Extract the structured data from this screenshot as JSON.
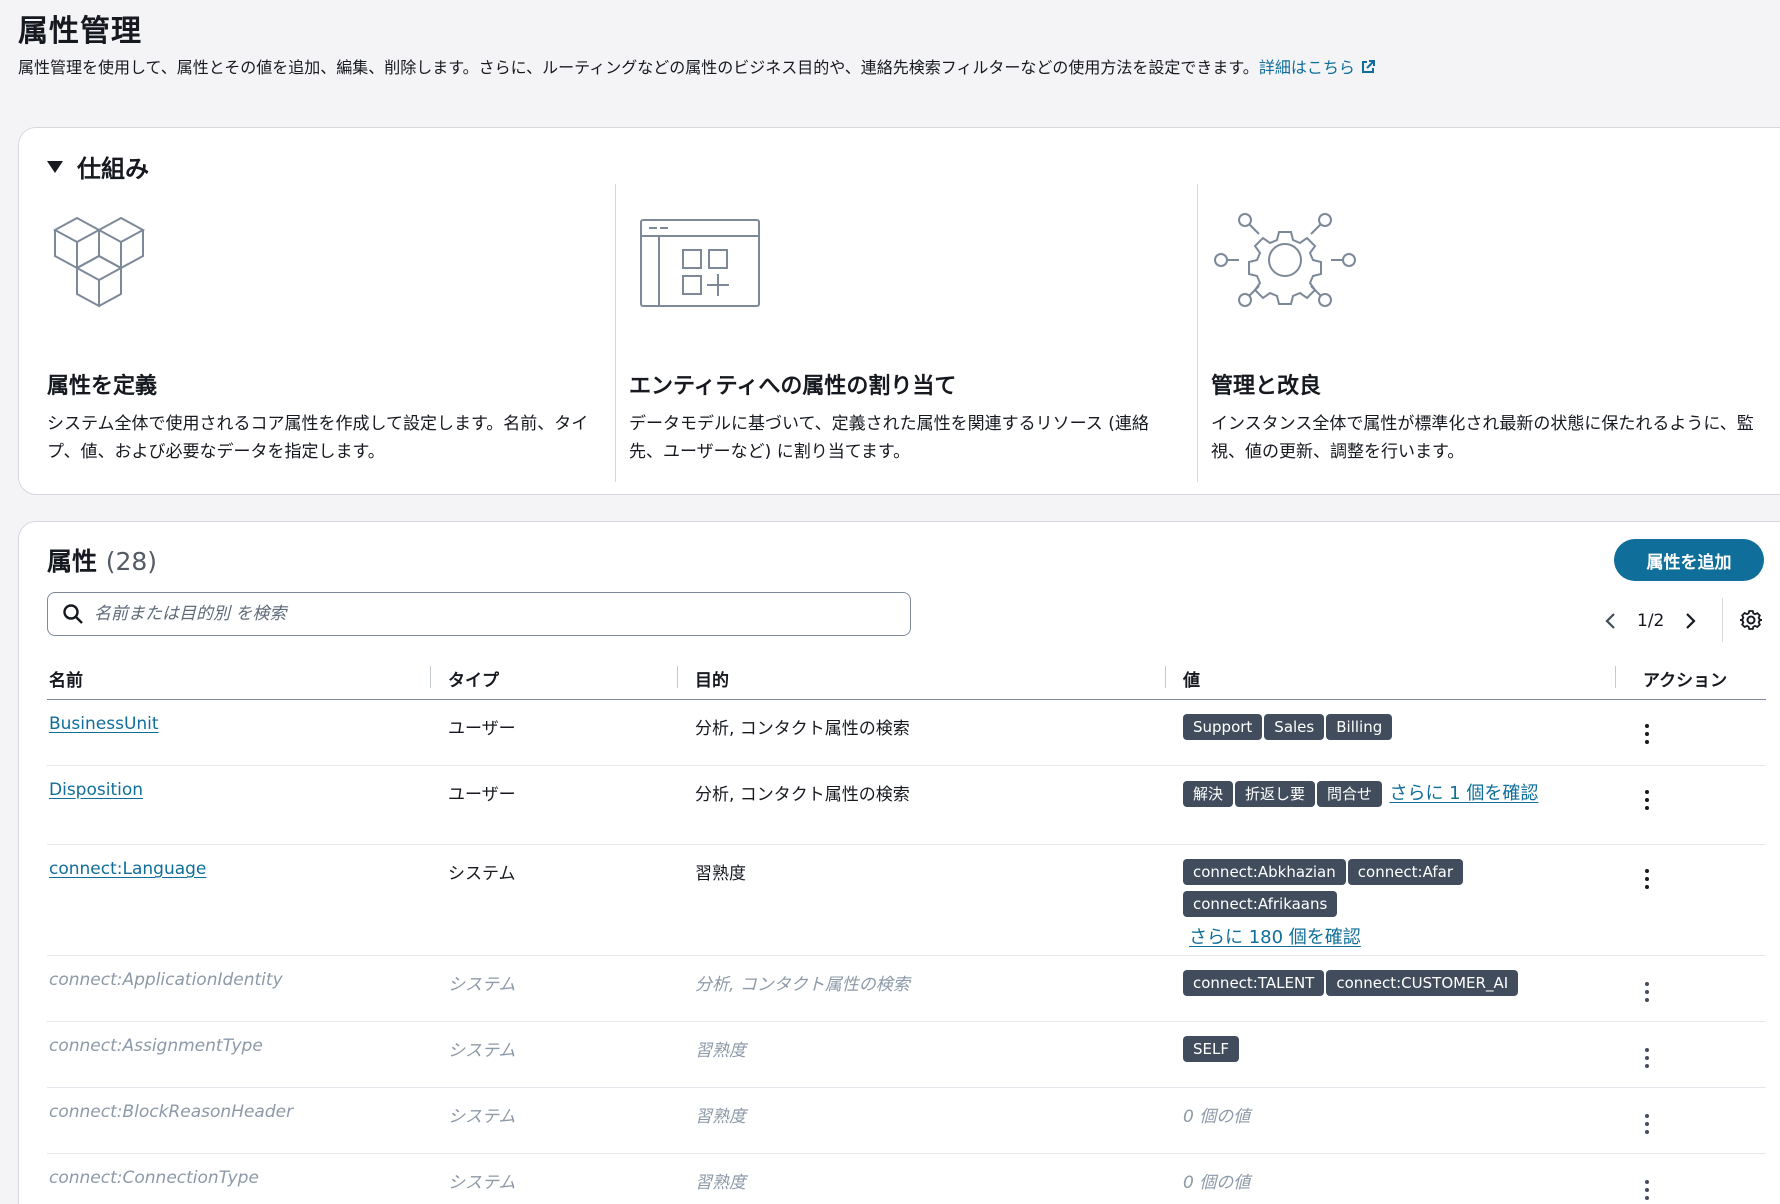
{
  "page": {
    "title": "属性管理",
    "description": "属性管理を使用して、属性とその値を追加、編集、削除します。さらに、ルーティングなどの属性のビジネス目的や、連絡先検索フィルターなどの使用方法を設定できます。",
    "learn_more": "詳細はこちら"
  },
  "how": {
    "toggle_label": "仕組み",
    "columns": [
      {
        "icon": "cubes-icon",
        "title": "属性を定義",
        "body": "システム全体で使用されるコア属性を作成して設定します。名前、タイプ、値、および必要なデータを指定します。"
      },
      {
        "icon": "layout-add-icon",
        "title": "エンティティへの属性の割り当て",
        "body": "データモデルに基づいて、定義された属性を関連するリソース (連絡先、ユーザーなど) に割り当てます。"
      },
      {
        "icon": "gear-network-icon",
        "title": "管理と改良",
        "body": "インスタンス全体で属性が標準化され最新の状態に保たれるように、監視、値の更新、調整を行います。"
      }
    ]
  },
  "attributes": {
    "title": "属性",
    "count": "(28)",
    "add_button": "属性を追加",
    "search_placeholder": "名前または目的別 を検索",
    "pagination": "1/2",
    "columns": {
      "name": "名前",
      "type": "タイプ",
      "purpose": "目的",
      "values": "値",
      "action": "アクション"
    },
    "rows": [
      {
        "name": "BusinessUnit",
        "type": "ユーザー",
        "purpose": "分析, コンタクト属性の検索",
        "chips": [
          "Support",
          "Sales",
          "Billing"
        ]
      },
      {
        "name": "Disposition",
        "type": "ユーザー",
        "purpose": "分析, コンタクト属性の検索",
        "chips": [
          "解決",
          "折返し要",
          "問合せ"
        ],
        "more": "さらに 1 個を確認"
      },
      {
        "name": "connect:Language",
        "type": "システム",
        "purpose": "習熟度",
        "chips": [
          "connect:Abkhazian",
          "connect:Afar",
          "connect:Afrikaans"
        ],
        "more": "さらに 180 個を確認"
      },
      {
        "name": "connect:ApplicationIdentity",
        "type": "システム",
        "purpose": "分析, コンタクト属性の検索",
        "chips": [
          "connect:TALENT",
          "connect:CUSTOMER_AI"
        ]
      },
      {
        "name": "connect:AssignmentType",
        "type": "システム",
        "purpose": "習熟度",
        "chips": [
          "SELF"
        ]
      },
      {
        "name": "connect:BlockReasonHeader",
        "type": "システム",
        "purpose": "習熟度",
        "empty": "0 個の値"
      },
      {
        "name": "connect:ConnectionType",
        "type": "システム",
        "purpose": "習熟度",
        "empty": "0 個の値"
      }
    ]
  }
}
